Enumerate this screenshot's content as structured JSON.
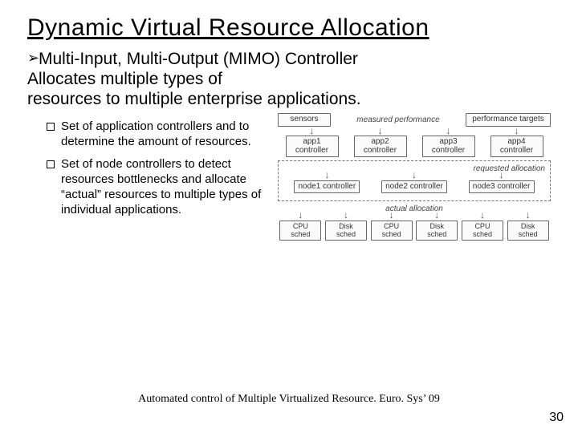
{
  "title": "Dynamic Virtual Resource Allocation",
  "bullet1_lead": "Multi-Input, Multi-Output (MIMO) Controller",
  "bullet1_body": "Allocates multiple types of\nresources to multiple enterprise applications.",
  "subbullets": [
    "Set of application controllers and to determine the amount of resources.",
    "Set of node controllers to detect resources bottlenecks and allocate “actual” resources to multiple types of individual applications."
  ],
  "diagram": {
    "top_left": "sensors",
    "top_right": "performance targets",
    "mid_label_left": "measured performance",
    "apps": [
      "app1 controller",
      "app2 controller",
      "app3 controller",
      "app4 controller"
    ],
    "req_label": "requested allocation",
    "nodes": [
      "node1 controller",
      "node2 controller",
      "node3 controller"
    ],
    "act_label": "actual allocation",
    "scheds": [
      "CPU sched",
      "Disk sched",
      "CPU sched",
      "Disk sched",
      "CPU sched",
      "Disk sched"
    ]
  },
  "reference": "Automated control of Multiple Virtualized Resource. Euro. Sys’ 09",
  "page": "30"
}
